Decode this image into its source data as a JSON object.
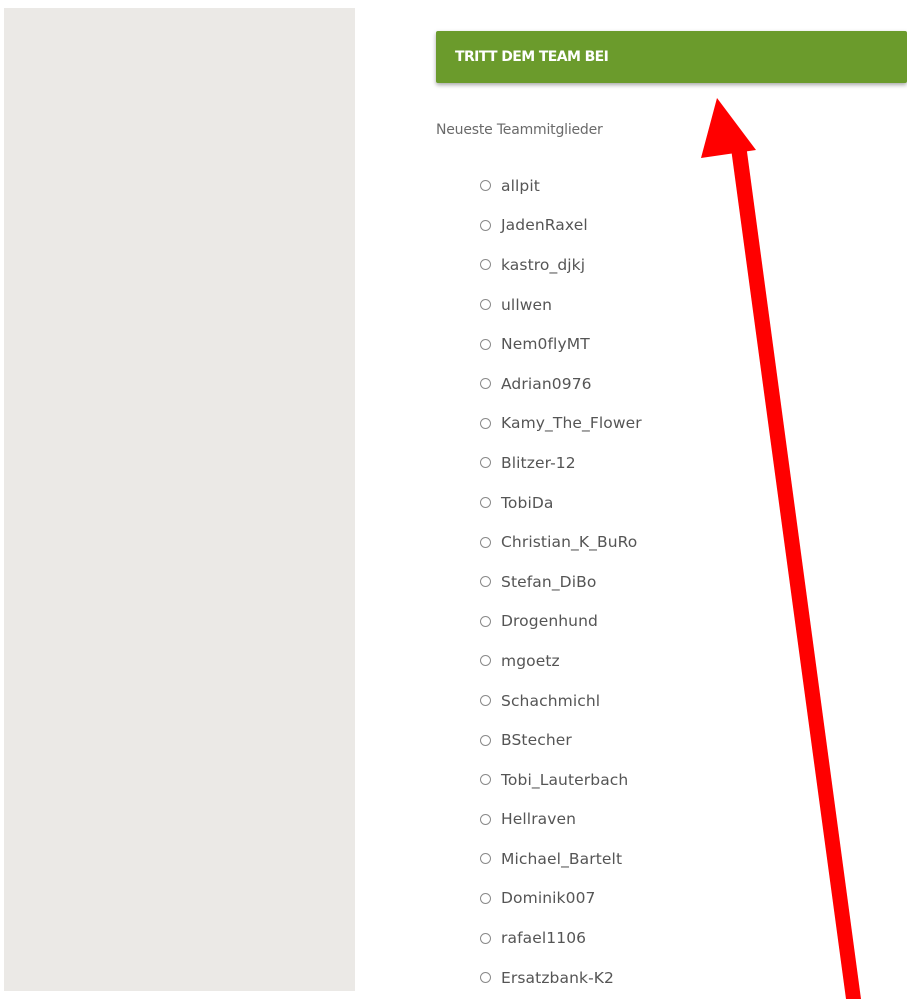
{
  "join_button": {
    "label": "TRITT DEM TEAM BEI"
  },
  "members_section": {
    "title": "Neueste Teammitglieder",
    "members": [
      "allpit",
      "JadenRaxel",
      "kastro_djkj",
      "ullwen",
      "Nem0flyMT",
      "Adrian0976",
      "Kamy_The_Flower",
      "Blitzer-12",
      "TobiDa",
      "Christian_K_BuRo",
      "Stefan_DiBo",
      "Drogenhund",
      "mgoetz",
      "Schachmichl",
      "BStecher",
      "Tobi_Lauterbach",
      "Hellraven",
      "Michael_Bartelt",
      "Dominik007",
      "rafael1106",
      "Ersatzbank-K2"
    ]
  },
  "colors": {
    "button_green": "#6b9b2c",
    "sidebar_gray": "#ebe9e6",
    "annotation_arrow": "#ff0000"
  },
  "annotation": {
    "icon": "red-arrow-icon"
  }
}
